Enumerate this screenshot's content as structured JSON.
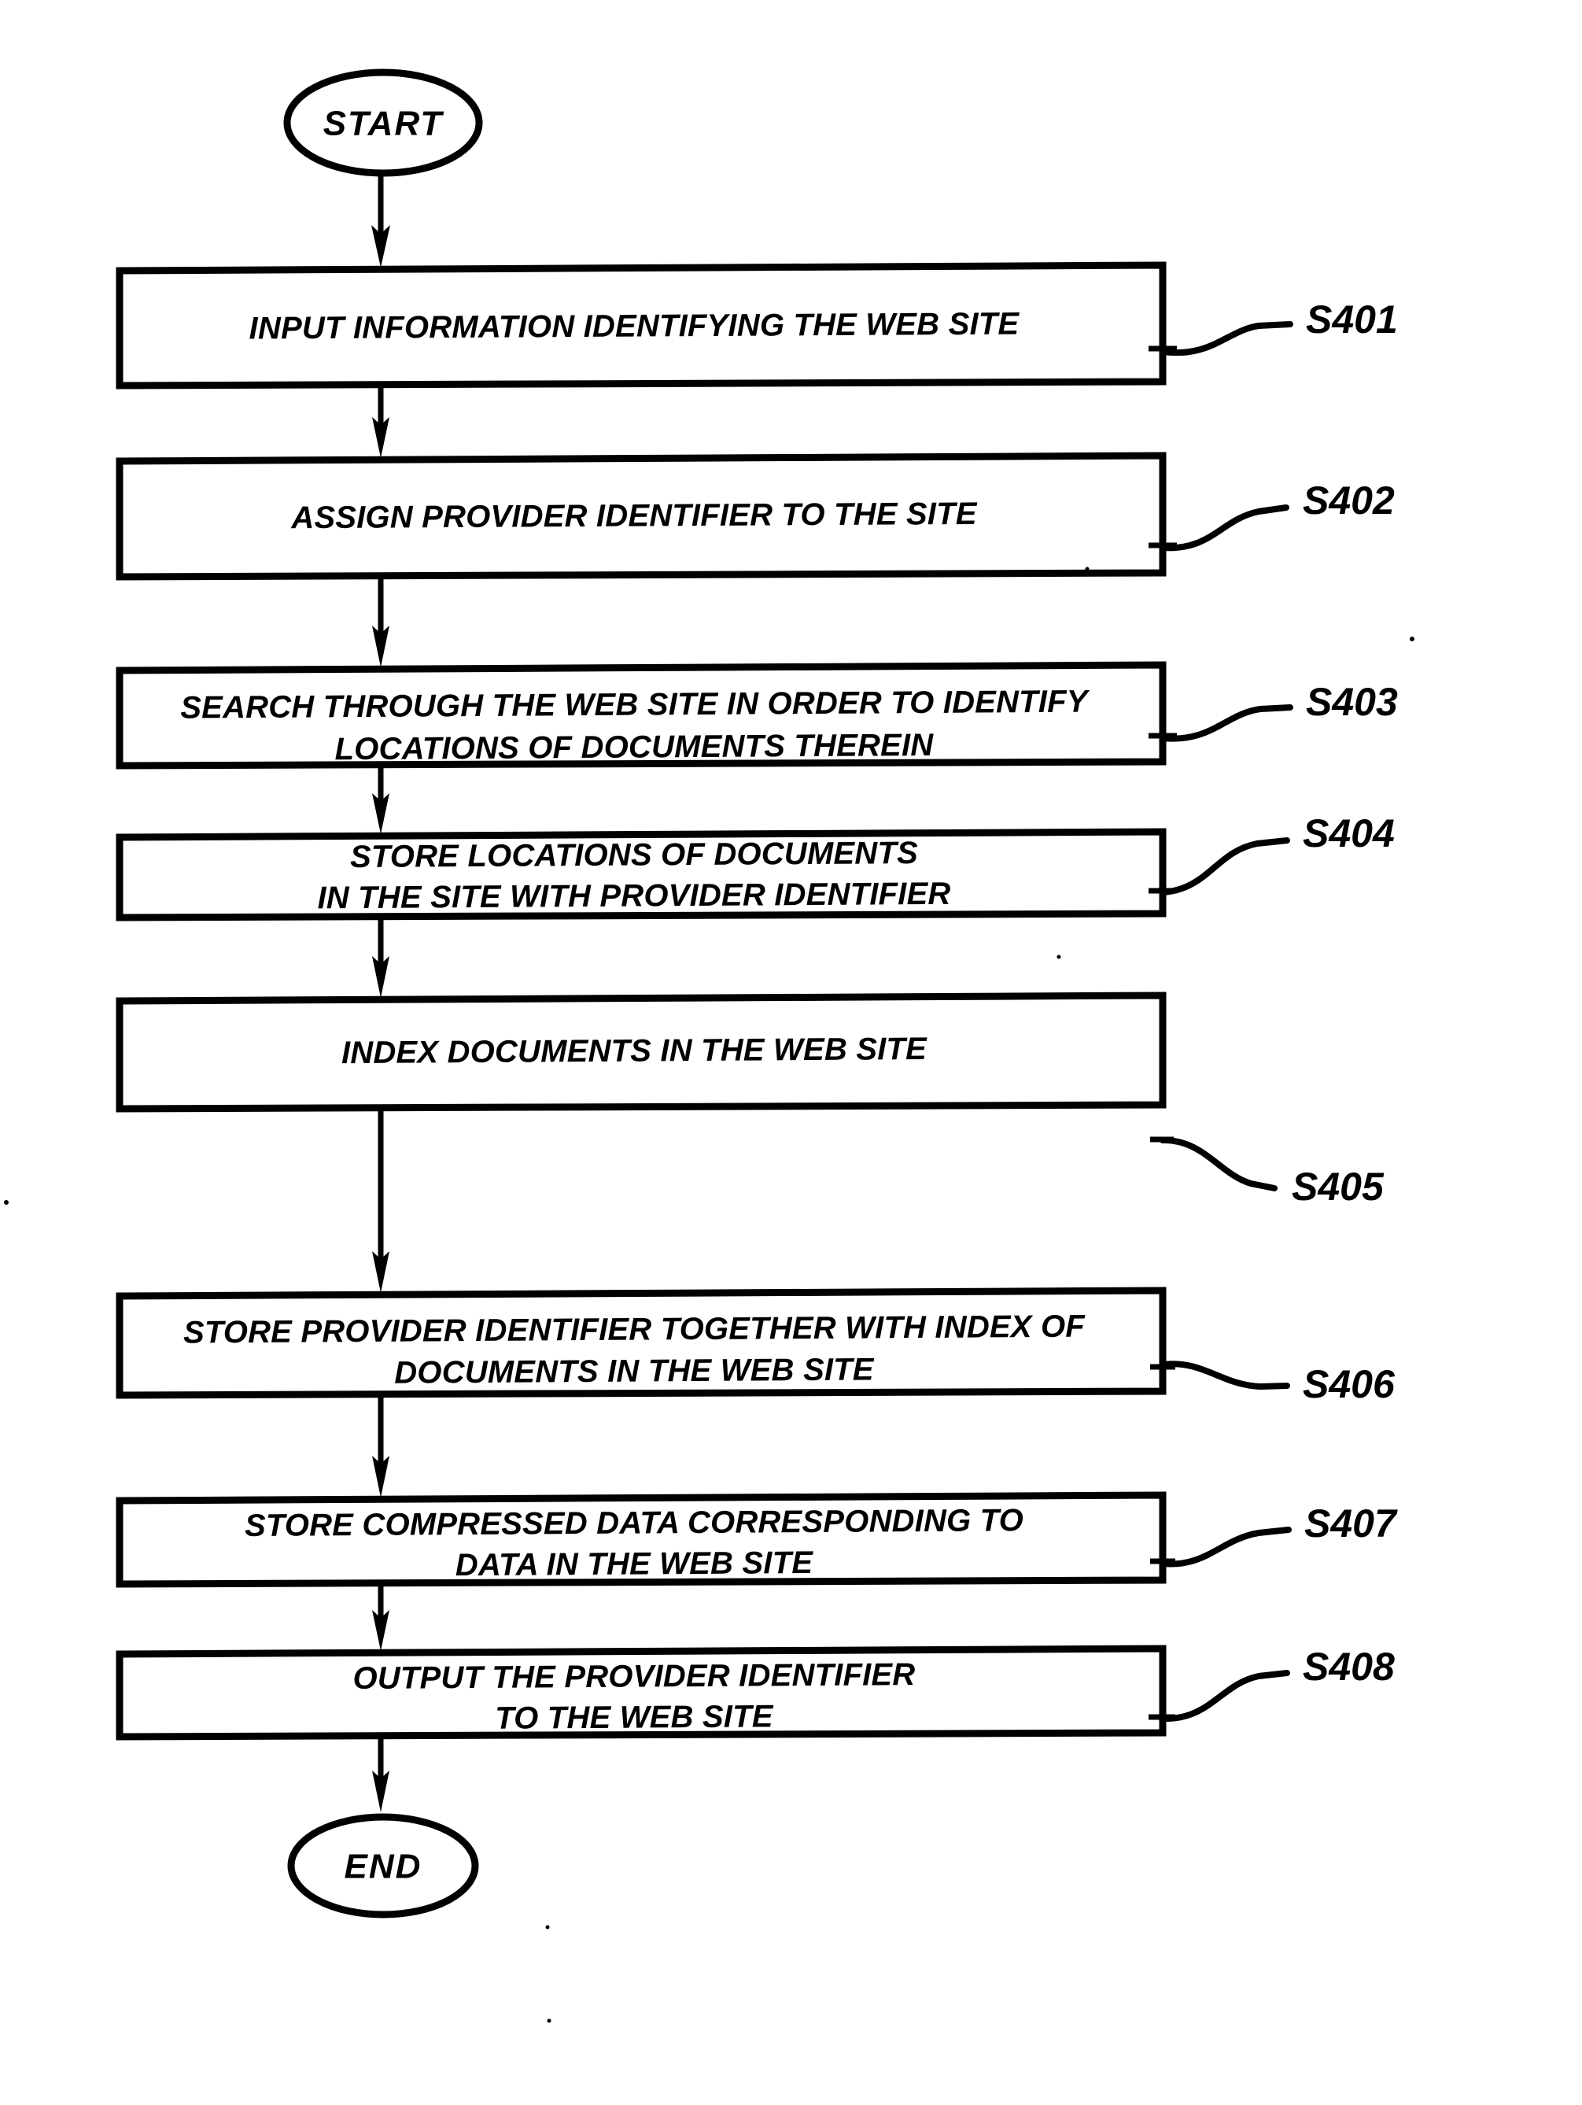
{
  "figure": {
    "type": "flowchart",
    "orientation": "vertical",
    "title": "",
    "start_node": {
      "label": "START",
      "shape": "ellipse"
    },
    "end_node": {
      "label": "END",
      "shape": "ellipse"
    },
    "steps": [
      {
        "ref": "S401",
        "shape": "process",
        "lines": [
          "INPUT INFORMATION IDENTIFYING THE WEB SITE"
        ]
      },
      {
        "ref": "S402",
        "shape": "process",
        "lines": [
          "ASSIGN PROVIDER IDENTIFIER TO THE SITE"
        ]
      },
      {
        "ref": "S403",
        "shape": "process",
        "lines": [
          "SEARCH THROUGH THE WEB SITE IN ORDER TO IDENTIFY",
          "LOCATIONS OF DOCUMENTS THEREIN"
        ]
      },
      {
        "ref": "S404",
        "shape": "process",
        "lines": [
          "STORE LOCATIONS OF DOCUMENTS",
          "IN THE SITE WITH PROVIDER IDENTIFIER"
        ]
      },
      {
        "ref": "S405",
        "shape": "process",
        "lines": [
          "INDEX DOCUMENTS IN THE WEB SITE"
        ]
      },
      {
        "ref": "S406",
        "shape": "process",
        "lines": [
          "STORE PROVIDER IDENTIFIER TOGETHER WITH INDEX OF",
          "DOCUMENTS IN THE WEB SITE"
        ]
      },
      {
        "ref": "S407",
        "shape": "process",
        "lines": [
          "STORE COMPRESSED DATA CORRESPONDING TO",
          "DATA IN THE WEB SITE"
        ]
      },
      {
        "ref": "S408",
        "shape": "process",
        "lines": [
          "OUTPUT THE PROVIDER IDENTIFIER",
          "TO THE WEB SITE"
        ]
      }
    ],
    "colors": {
      "stroke": "#000000",
      "fill": "#ffffff",
      "background": "#ffffff"
    }
  }
}
